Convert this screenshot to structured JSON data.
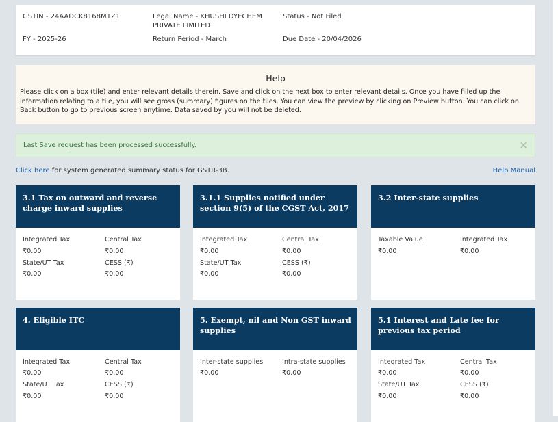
{
  "info": {
    "gstin": "GSTIN - 24AADCK8168M1Z1",
    "legal_name_line1": "Legal Name - KHUSHI DYECHEM",
    "legal_name_line2": "PRIVATE LIMITED",
    "status": "Status - Not Filed",
    "fy": "FY - 2025-26",
    "return_period": "Return Period - March",
    "due_date": "Due Date - 20/04/2026"
  },
  "help": {
    "title": "Help",
    "text": "Please click on a box (tile) and enter relevant details therein. Save and click on the next box to enter relevant details. Once you have filled up the information relating to a tile, you will see gross (summary) figures on the tiles. You can view the preview by clicking on Preview button. You can click on Back button to go to previous screen anytime. Data saved by you will not be deleted."
  },
  "alert": {
    "text": "Last Save request has been processed successfully.",
    "close": "×"
  },
  "summary": {
    "link": "Click here",
    "rest": " for system generated summary status for GSTR-3B.",
    "help_manual": "Help Manual"
  },
  "tiles": [
    {
      "title": "3.1 Tax on outward and reverse charge inward supplies",
      "fields": [
        {
          "label": "Integrated Tax",
          "value": "₹0.00"
        },
        {
          "label": "Central Tax",
          "value": "₹0.00"
        },
        {
          "label": "State/UT Tax",
          "value": "₹0.00"
        },
        {
          "label": "CESS (₹)",
          "value": "₹0.00"
        }
      ]
    },
    {
      "title": "3.1.1 Supplies notified under section 9(5) of the CGST Act, 2017",
      "fields": [
        {
          "label": "Integrated Tax",
          "value": "₹0.00"
        },
        {
          "label": "Central Tax",
          "value": "₹0.00"
        },
        {
          "label": "State/UT Tax",
          "value": "₹0.00"
        },
        {
          "label": "CESS (₹)",
          "value": "₹0.00"
        }
      ]
    },
    {
      "title": "3.2 Inter-state supplies",
      "fields": [
        {
          "label": "Taxable Value",
          "value": "₹0.00"
        },
        {
          "label": "Integrated Tax",
          "value": "₹0.00"
        }
      ]
    },
    {
      "title": "4. Eligible ITC",
      "fields": [
        {
          "label": "Integrated Tax",
          "value": "₹0.00"
        },
        {
          "label": "Central Tax",
          "value": "₹0.00"
        },
        {
          "label": "State/UT Tax",
          "value": "₹0.00"
        },
        {
          "label": "CESS (₹)",
          "value": "₹0.00"
        }
      ]
    },
    {
      "title": "5. Exempt, nil and Non GST inward supplies",
      "fields": [
        {
          "label": "Inter-state supplies",
          "value": "₹0.00"
        },
        {
          "label": "Intra-state supplies",
          "value": "₹0.00"
        }
      ]
    },
    {
      "title": "5.1 Interest and Late fee for previous tax period",
      "fields": [
        {
          "label": "Integrated Tax",
          "value": "₹0.00"
        },
        {
          "label": "Central Tax",
          "value": "₹0.00"
        },
        {
          "label": "State/UT Tax",
          "value": "₹0.00"
        },
        {
          "label": "CESS (₹)",
          "value": "₹0.00"
        }
      ]
    }
  ]
}
